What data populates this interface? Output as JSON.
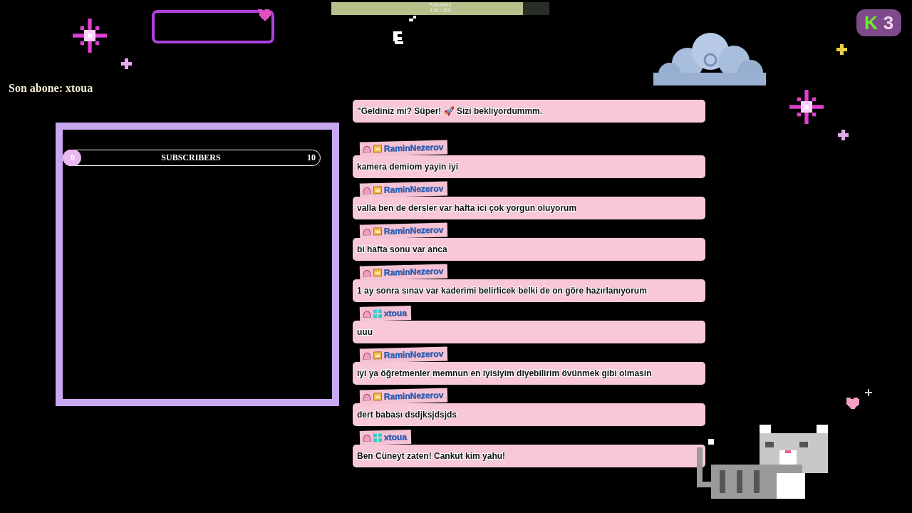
{
  "followers_goal": {
    "label": "Followers",
    "count": "176 / 200",
    "level": 0.88
  },
  "latest_subscriber": "Son abone: xtoua",
  "subscriber_goal": {
    "start": "0",
    "label": "SUBSCRIBERS",
    "end": "10",
    "level": 0
  },
  "viewer_badge": {
    "letter": "K",
    "count": "3"
  },
  "chat": [
    {
      "text": "\"Geldiniz mi? Süper! 🚀 Sizi bekliyordummm."
    },
    {
      "user": "RaminNezerov",
      "kind": "crown",
      "text": "kamera demiom yayin iyi"
    },
    {
      "user": "RaminNezerov",
      "kind": "crown",
      "text": "valla ben de dersler var hafta ici çok yorgun oluyorum"
    },
    {
      "user": "RaminNezerov",
      "kind": "crown",
      "text": "bi hafta sonu var anca"
    },
    {
      "user": "RaminNezerov",
      "kind": "crown",
      "text": "1 ay sonra sınav var kaderimi belirlicek belki de on göre hazırlanıyorum"
    },
    {
      "user": "xtoua",
      "kind": "grid",
      "text": "uuu"
    },
    {
      "user": "RaminNezerov",
      "kind": "crown",
      "text": "iyi ya öğretmenler memnun en iyisiyim diyebilirim övünmek gibi olmasin"
    },
    {
      "user": "RaminNezerov",
      "kind": "crown",
      "text": "dert babası dsdjksjdsjds"
    },
    {
      "user": "xtoua",
      "kind": "grid",
      "text": "Ben Cüneyt zaten! Cankut kim yahu!"
    }
  ]
}
